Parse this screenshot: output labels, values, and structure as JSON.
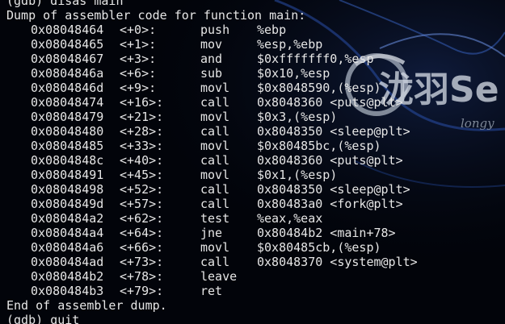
{
  "command": "(gdb) disas main",
  "header": "Dump of assembler code for function main:",
  "instructions": [
    {
      "addr": "0x08048464",
      "offset": "<+0>:",
      "instr": "push",
      "ops": "%ebp"
    },
    {
      "addr": "0x08048465",
      "offset": "<+1>:",
      "instr": "mov",
      "ops": "%esp,%ebp"
    },
    {
      "addr": "0x08048467",
      "offset": "<+3>:",
      "instr": "and",
      "ops": "$0xfffffff0,%esp"
    },
    {
      "addr": "0x0804846a",
      "offset": "<+6>:",
      "instr": "sub",
      "ops": "$0x10,%esp"
    },
    {
      "addr": "0x0804846d",
      "offset": "<+9>:",
      "instr": "movl",
      "ops": "$0x8048590,(%esp)"
    },
    {
      "addr": "0x08048474",
      "offset": "<+16>:",
      "instr": "call",
      "ops": "0x8048360 <puts@plt>"
    },
    {
      "addr": "0x08048479",
      "offset": "<+21>:",
      "instr": "movl",
      "ops": "$0x3,(%esp)"
    },
    {
      "addr": "0x08048480",
      "offset": "<+28>:",
      "instr": "call",
      "ops": "0x8048350 <sleep@plt>"
    },
    {
      "addr": "0x08048485",
      "offset": "<+33>:",
      "instr": "movl",
      "ops": "$0x80485bc,(%esp)"
    },
    {
      "addr": "0x0804848c",
      "offset": "<+40>:",
      "instr": "call",
      "ops": "0x8048360 <puts@plt>"
    },
    {
      "addr": "0x08048491",
      "offset": "<+45>:",
      "instr": "movl",
      "ops": "$0x1,(%esp)"
    },
    {
      "addr": "0x08048498",
      "offset": "<+52>:",
      "instr": "call",
      "ops": "0x8048350 <sleep@plt>"
    },
    {
      "addr": "0x0804849d",
      "offset": "<+57>:",
      "instr": "call",
      "ops": "0x80483a0 <fork@plt>"
    },
    {
      "addr": "0x080484a2",
      "offset": "<+62>:",
      "instr": "test",
      "ops": "%eax,%eax"
    },
    {
      "addr": "0x080484a4",
      "offset": "<+64>:",
      "instr": "jne",
      "ops": "0x80484b2 <main+78>"
    },
    {
      "addr": "0x080484a6",
      "offset": "<+66>:",
      "instr": "movl",
      "ops": "$0x80485cb,(%esp)"
    },
    {
      "addr": "0x080484ad",
      "offset": "<+73>:",
      "instr": "call",
      "ops": "0x8048370 <system@plt>"
    },
    {
      "addr": "0x080484b2",
      "offset": "<+78>:",
      "instr": "leave",
      "ops": ""
    },
    {
      "addr": "0x080484b3",
      "offset": "<+79>:",
      "instr": "ret",
      "ops": ""
    }
  ],
  "footer": "End of assembler dump.",
  "prompt": "(gdb) quit",
  "watermark": {
    "brand": "泷羽Se",
    "domain": "longy"
  },
  "colors": {
    "background": "#02040a",
    "text": "#e6e6e6",
    "wallpaper_glow": "#1e3f8f"
  }
}
